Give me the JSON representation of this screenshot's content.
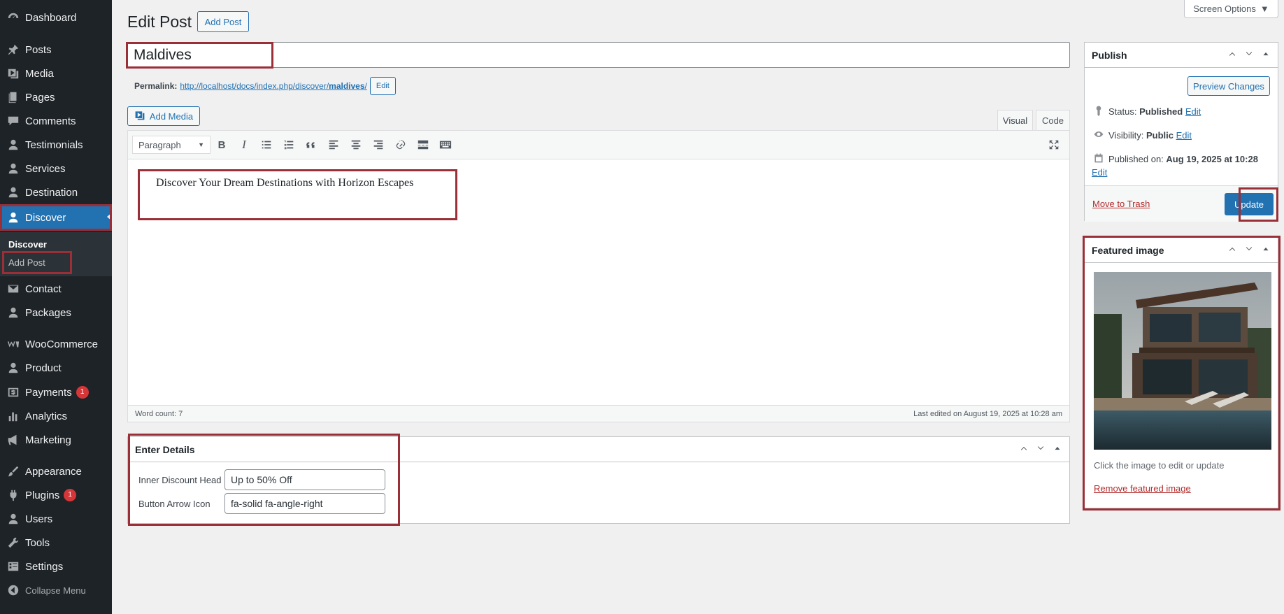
{
  "sidebar": {
    "items": [
      {
        "label": "Dashboard",
        "icon": "dashboard-icon"
      },
      {
        "label": "Posts",
        "icon": "pin-icon"
      },
      {
        "label": "Media",
        "icon": "media-icon"
      },
      {
        "label": "Pages",
        "icon": "pages-icon"
      },
      {
        "label": "Comments",
        "icon": "comments-icon"
      },
      {
        "label": "Testimonials",
        "icon": "user-icon"
      },
      {
        "label": "Services",
        "icon": "user-icon"
      },
      {
        "label": "Destination",
        "icon": "user-icon"
      },
      {
        "label": "Discover",
        "icon": "user-icon"
      },
      {
        "label": "Contact",
        "icon": "email-icon"
      },
      {
        "label": "Packages",
        "icon": "user-icon"
      },
      {
        "label": "WooCommerce",
        "icon": "woocommerce-icon"
      },
      {
        "label": "Product",
        "icon": "user-icon"
      },
      {
        "label": "Payments",
        "icon": "dollar-icon",
        "badge": "1"
      },
      {
        "label": "Analytics",
        "icon": "chart-icon"
      },
      {
        "label": "Marketing",
        "icon": "megaphone-icon"
      },
      {
        "label": "Appearance",
        "icon": "brush-icon"
      },
      {
        "label": "Plugins",
        "icon": "plugin-icon",
        "badge": "1"
      },
      {
        "label": "Users",
        "icon": "user-icon"
      },
      {
        "label": "Tools",
        "icon": "wrench-icon"
      },
      {
        "label": "Settings",
        "icon": "settings-icon"
      },
      {
        "label": "Collapse Menu",
        "icon": "collapse-icon"
      }
    ],
    "submenu": {
      "head": "Discover",
      "item": "Add Post"
    }
  },
  "header": {
    "title": "Edit Post",
    "add_post": "Add Post",
    "screen_options": "Screen Options"
  },
  "post": {
    "title": "Maldives",
    "permalink_label": "Permalink:",
    "permalink_base": "http://localhost/docs/index.php/discover/",
    "permalink_slug": "maldives",
    "permalink_trail": "/",
    "edit_label": "Edit"
  },
  "editor": {
    "add_media": "Add Media",
    "tab_visual": "Visual",
    "tab_code": "Code",
    "format": "Paragraph",
    "content": "Discover Your Dream Destinations with Horizon Escapes",
    "word_count": "Word count: 7",
    "last_edited": "Last edited on August 19, 2025 at 10:28 am"
  },
  "details": {
    "title": "Enter Details",
    "fields": [
      {
        "label": "Inner Discount Head",
        "value": "Up to 50% Off"
      },
      {
        "label": "Button Arrow Icon",
        "value": "fa-solid fa-angle-right"
      }
    ]
  },
  "publish": {
    "title": "Publish",
    "preview": "Preview Changes",
    "status_label": "Status:",
    "status_value": "Published",
    "visibility_label": "Visibility:",
    "visibility_value": "Public",
    "published_label": "Published on:",
    "published_value": "Aug 19, 2025 at 10:28",
    "edit": "Edit",
    "trash": "Move to Trash",
    "update": "Update"
  },
  "featured": {
    "title": "Featured image",
    "caption": "Click the image to edit or update",
    "remove": "Remove featured image"
  }
}
